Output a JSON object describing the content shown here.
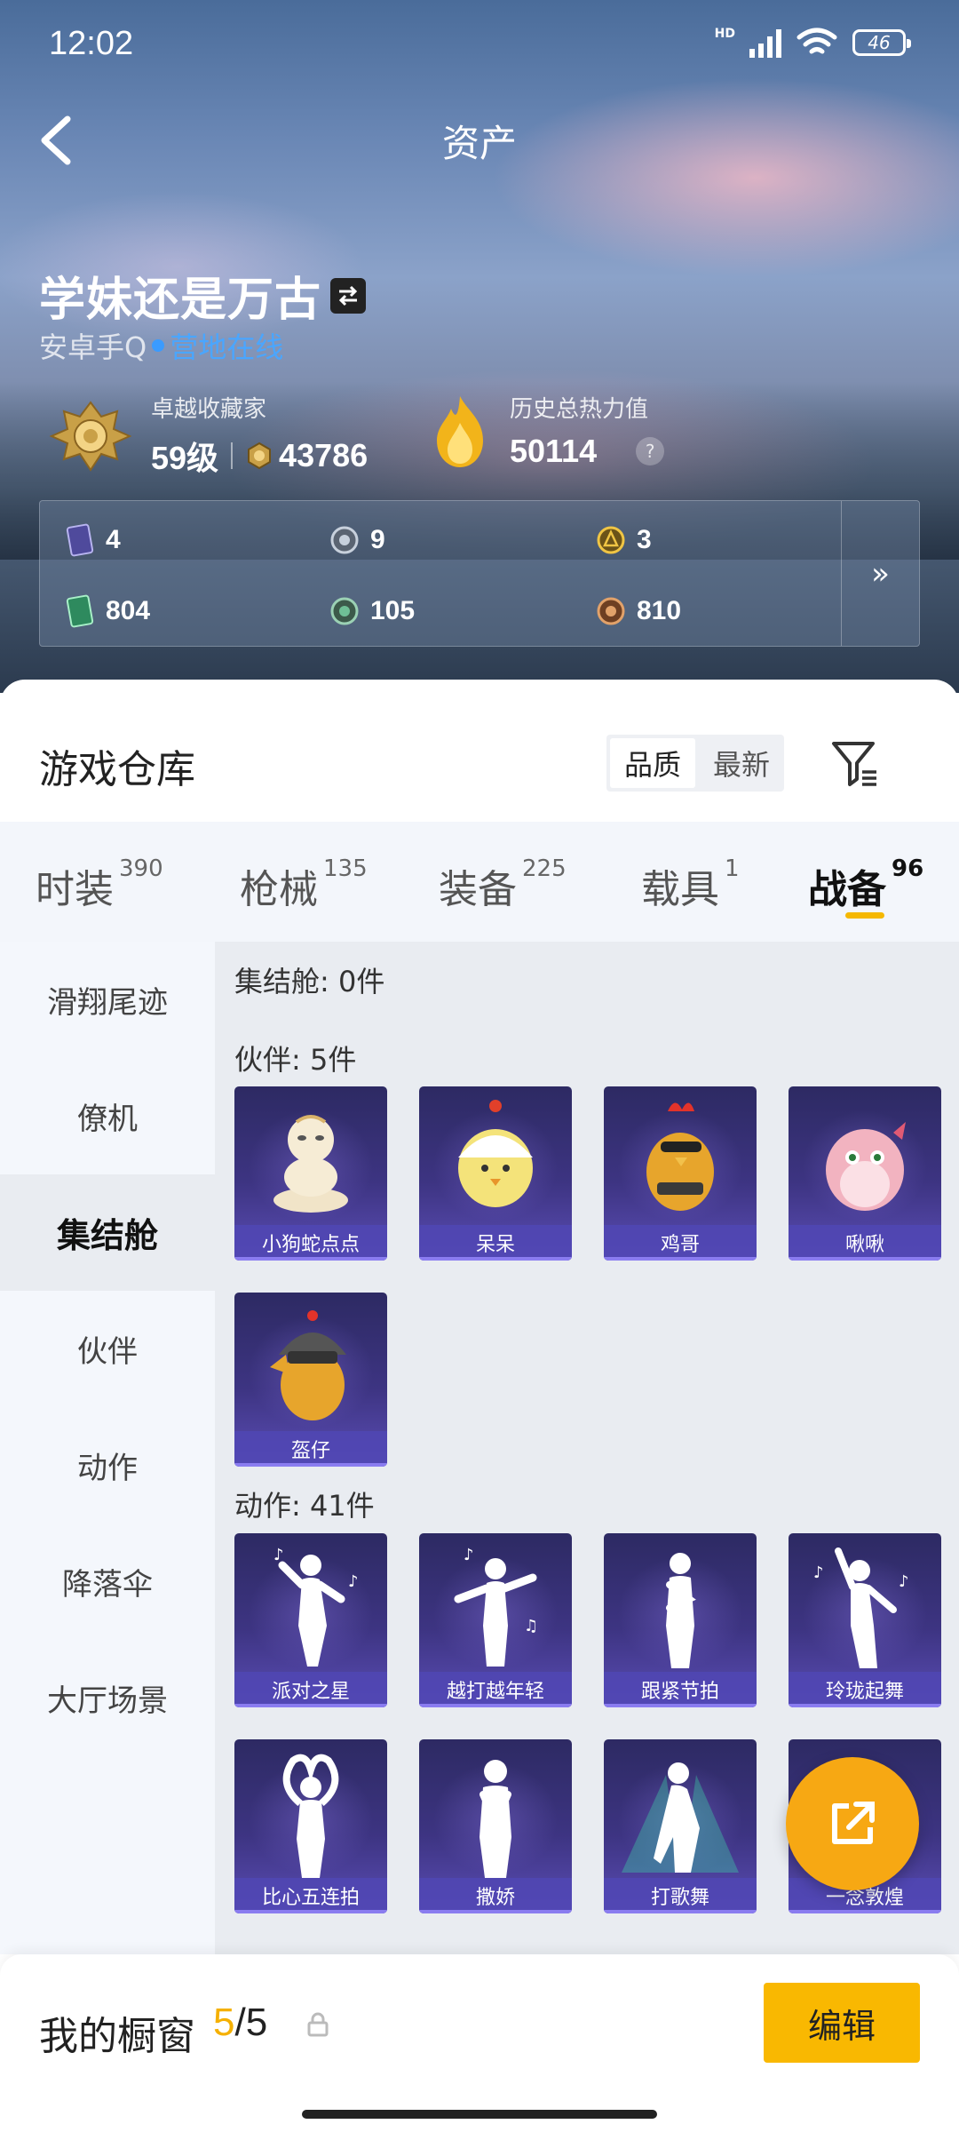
{
  "status_bar": {
    "time": "12:02",
    "network": "HD",
    "battery": "46"
  },
  "header": {
    "title": "资产",
    "username": "学妹还是万古",
    "account": "安卓手Q",
    "online_status": "营地在线"
  },
  "rank": {
    "title": "卓越收藏家",
    "level": "59级",
    "points": "43786"
  },
  "heat": {
    "title": "历史总热力值",
    "value": "50114",
    "help": "?"
  },
  "assets": [
    {
      "icon": "card-icon",
      "value": "4"
    },
    {
      "icon": "silver-coin-icon",
      "value": "9"
    },
    {
      "icon": "gold-coin-icon",
      "value": "3"
    },
    {
      "icon": "green-card-icon",
      "value": "804"
    },
    {
      "icon": "green-coin-icon",
      "value": "105"
    },
    {
      "icon": "bronze-coin-icon",
      "value": "810"
    }
  ],
  "assets_more": "»",
  "warehouse": {
    "title": "游戏仓库",
    "sort_options": [
      "品质",
      "最新"
    ],
    "sort_selected": "品质"
  },
  "tabs": [
    {
      "label": "时装",
      "count": "390"
    },
    {
      "label": "枪械",
      "count": "135"
    },
    {
      "label": "装备",
      "count": "225"
    },
    {
      "label": "载具",
      "count": "1"
    },
    {
      "label": "战备",
      "count": "96"
    }
  ],
  "active_tab": "战备",
  "side_nav": [
    "滑翔尾迹",
    "僚机",
    "集结舱",
    "伙伴",
    "动作",
    "降落伞",
    "大厅场景"
  ],
  "side_nav_active": "集结舱",
  "sections": {
    "assembly": "集结舱: 0件",
    "partners": "伙伴: 5件",
    "actions": "动作: 41件"
  },
  "partners": [
    "小狗蛇点点",
    "呆呆",
    "鸡哥",
    "啾啾",
    "盔仔"
  ],
  "actions": [
    "派对之星",
    "越打越年轻",
    "跟紧节拍",
    "玲珑起舞",
    "比心五连拍",
    "撒娇",
    "打歌舞",
    "一念敦煌"
  ],
  "showcase": {
    "title": "我的橱窗",
    "current": "5",
    "total": "/5",
    "edit_label": "编辑"
  },
  "colors": {
    "accent": "#f9b801",
    "card_bg": "#3d3482",
    "online": "#4aa6ff"
  }
}
